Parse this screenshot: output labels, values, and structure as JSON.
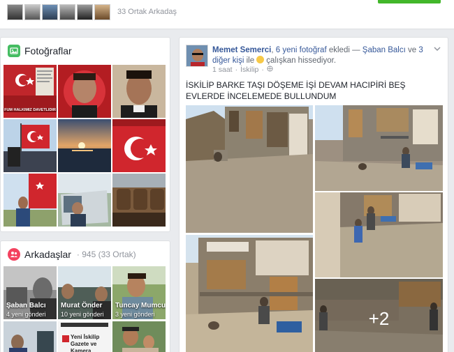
{
  "mutual": {
    "text": "33 Ortak Arkadaş"
  },
  "photos": {
    "title": "Fotoğraflar",
    "tile1_text": "FÜM HALKIMIZ DAVETLİDİR"
  },
  "friends": {
    "title": "Arkadaşlar",
    "count": "· 945 (33 Ortak)",
    "items": [
      {
        "name": "Şaban Balcı",
        "sent": "4 yeni gönderi"
      },
      {
        "name": "Murat Önder",
        "sent": "10 yeni gönderi"
      },
      {
        "name": "Tuncay Mumcu",
        "sent": "3 yeni gönderi"
      }
    ],
    "row2_tile_text": "Yeni İskilip Gazete ve Kamera"
  },
  "post": {
    "author": "Memet Semerci",
    "mid1": ", ",
    "photos_link": "6 yeni fotoğraf",
    "mid2": " ekledi — ",
    "tagged": "Şaban Balcı",
    "mid3": " ve ",
    "others": "3 diğer kişi",
    "mid4": " ile ",
    "feeling": "çalışkan hissediyor.",
    "time": "1 saat",
    "location": "İskilip",
    "text": "İSKİLİP BARKE TAŞI DÖŞEME İŞİ DEVAM HACIPİRİ BEŞ EVLERDE İNCELEMEDE BULLUNDUM",
    "more_count": "+2"
  },
  "colors": {
    "link": "#365899",
    "green": "#42b72a",
    "photo_icon": "#45bd62",
    "friends_icon": "#f3425f"
  }
}
